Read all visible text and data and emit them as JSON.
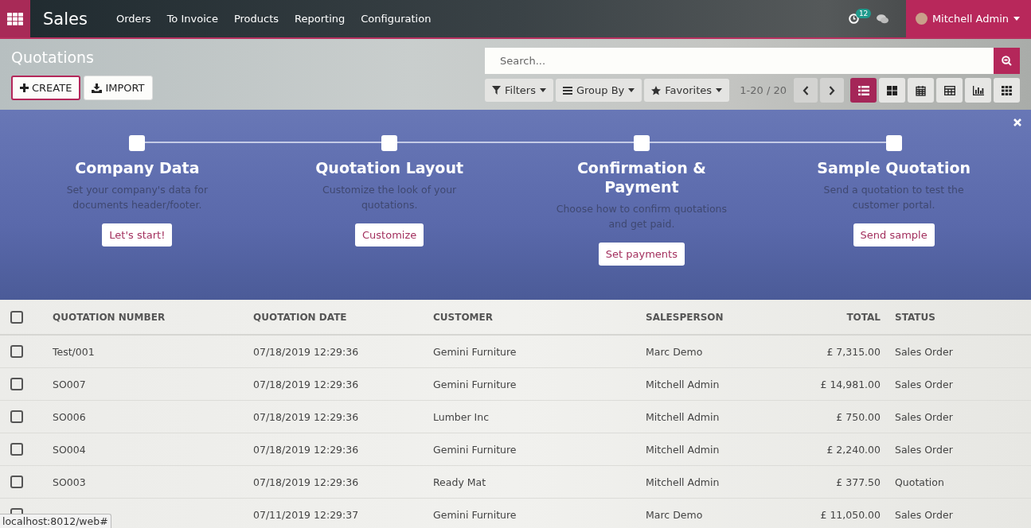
{
  "navbar": {
    "app_name": "Sales",
    "menu": [
      "Orders",
      "To Invoice",
      "Products",
      "Reporting",
      "Configuration"
    ],
    "activity_count": "12",
    "user": "Mitchell Admin"
  },
  "control_panel": {
    "title": "Quotations",
    "buttons": [
      {
        "label": "CREATE",
        "kind": "create"
      },
      {
        "label": "IMPORT",
        "kind": "import"
      }
    ],
    "search": {
      "placeholder": "Search..."
    },
    "filters": [
      {
        "label": "Filters",
        "kind": "filter"
      },
      {
        "label": "Group By",
        "kind": "group"
      },
      {
        "label": "Favorites",
        "kind": "star"
      }
    ],
    "pager": "1-20 / 20",
    "views": [
      {
        "kind": "list",
        "selected": true
      },
      {
        "kind": "kanban",
        "selected": false
      },
      {
        "kind": "calendar",
        "selected": false
      },
      {
        "kind": "pivot",
        "selected": false
      },
      {
        "kind": "graph",
        "selected": false
      },
      {
        "kind": "grid",
        "selected": false
      }
    ]
  },
  "onboarding": {
    "steps": [
      {
        "title": "Company Data",
        "description": "Set your company's data for documents header/footer.",
        "button": "Let's start!"
      },
      {
        "title": "Quotation Layout",
        "description": "Customize the look of your quotations.",
        "button": "Customize"
      },
      {
        "title": "Confirmation & Payment",
        "description": "Choose how to confirm quotations and get paid.",
        "button": "Set payments"
      },
      {
        "title": "Sample Quotation",
        "description": "Send a quotation to test the customer portal.",
        "button": "Send sample"
      }
    ]
  },
  "table": {
    "select_all": {
      "checked": false
    },
    "columns": [
      {
        "label": "QUOTATION NUMBER",
        "kind": "text"
      },
      {
        "label": "QUOTATION DATE",
        "kind": "text"
      },
      {
        "label": "CUSTOMER",
        "kind": "text"
      },
      {
        "label": "SALESPERSON",
        "kind": "text"
      },
      {
        "label": "TOTAL",
        "kind": "monetary"
      },
      {
        "label": "STATUS",
        "kind": "text"
      }
    ],
    "rows": [
      {
        "checked": false,
        "cells": [
          "Test/001",
          "07/18/2019 12:29:36",
          "Gemini Furniture",
          "Marc Demo",
          "£ 7,315.00",
          "Sales Order"
        ]
      },
      {
        "checked": false,
        "cells": [
          "SO007",
          "07/18/2019 12:29:36",
          "Gemini Furniture",
          "Mitchell Admin",
          "£ 14,981.00",
          "Sales Order"
        ]
      },
      {
        "checked": false,
        "cells": [
          "SO006",
          "07/18/2019 12:29:36",
          "Lumber Inc",
          "Mitchell Admin",
          "£ 750.00",
          "Sales Order"
        ]
      },
      {
        "checked": false,
        "cells": [
          "SO004",
          "07/18/2019 12:29:36",
          "Gemini Furniture",
          "Mitchell Admin",
          "£ 2,240.00",
          "Sales Order"
        ]
      },
      {
        "checked": false,
        "cells": [
          "SO003",
          "07/18/2019 12:29:36",
          "Ready Mat",
          "Mitchell Admin",
          "£ 377.50",
          "Quotation"
        ]
      },
      {
        "checked": false,
        "cells": [
          "",
          "07/11/2019 12:29:37",
          "Gemini Furniture",
          "Marc Demo",
          "£ 11,050.00",
          "Sales Order"
        ]
      }
    ]
  },
  "status_tooltip": "localhost:8012/web#"
}
